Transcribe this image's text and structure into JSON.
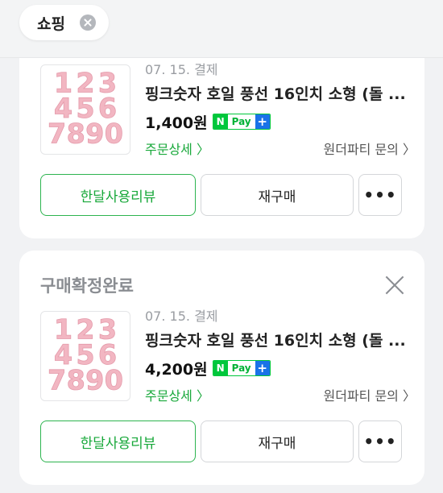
{
  "filter_chip": {
    "label": "쇼핑"
  },
  "orders": [
    {
      "status": "",
      "date": "07. 15. 결제",
      "title": "핑크숫자 호일 풍선 16인치 소형 (돌 ...",
      "price": "1,400원",
      "npay": {
        "n": "N",
        "pay": "Pay",
        "plus": "+"
      },
      "order_detail": "주문상세 〉",
      "seller_inquiry": "원더파티 문의 〉",
      "review_button": "한달사용리뷰",
      "rebuy_button": "재구매",
      "more_button": "•••",
      "thumbnail_digits": [
        "1",
        "2",
        "3",
        "4",
        "5",
        "6",
        "7",
        "8",
        "9",
        "0"
      ]
    },
    {
      "status": "구매확정완료",
      "date": "07. 15. 결제",
      "title": "핑크숫자 호일 풍선 16인치 소형 (돌 ...",
      "price": "4,200원",
      "npay": {
        "n": "N",
        "pay": "Pay",
        "plus": "+"
      },
      "order_detail": "주문상세 〉",
      "seller_inquiry": "원더파티 문의 〉",
      "review_button": "한달사용리뷰",
      "rebuy_button": "재구매",
      "more_button": "•••",
      "thumbnail_digits": [
        "1",
        "2",
        "3",
        "4",
        "5",
        "6",
        "7",
        "8",
        "9",
        "0"
      ]
    }
  ],
  "colors": {
    "accent_green": "#18a83a",
    "npay_green": "#00c73c",
    "npay_blue": "#1a73e8",
    "balloon_pink": "#f2b6c2"
  }
}
